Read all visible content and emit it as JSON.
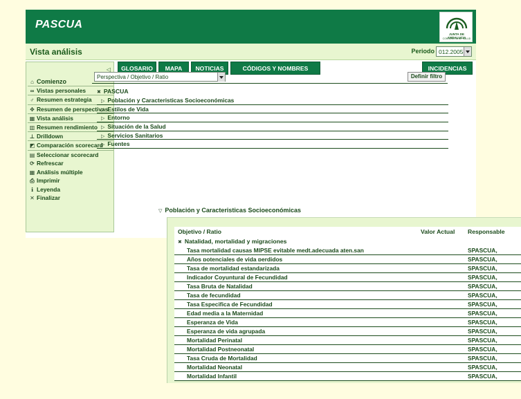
{
  "app": {
    "title": "PASCUA",
    "logo_text": "JUNTA DE ANDALUCIA",
    "logo_sub": "CONSEJERIA DE SALUD"
  },
  "subbar": {
    "view_title": "Vista análisis",
    "period_label": "Periodo",
    "period_value": "012.2005"
  },
  "sidebar": {
    "collapse_symbol": "◁",
    "items": [
      {
        "label": "Comienzo",
        "icon": "home-icon",
        "glyph": "⌂"
      },
      {
        "label": "Vistas personales",
        "icon": "glasses-icon",
        "glyph": "∞"
      },
      {
        "label": "Resumen estrategia",
        "icon": "strategy-icon",
        "glyph": "♂"
      },
      {
        "label": "Resumen de perspectivas",
        "icon": "perspectives-icon",
        "glyph": "✥"
      },
      {
        "label": "Vista análisis",
        "icon": "analysis-grid-icon",
        "glyph": "▦"
      },
      {
        "label": "Resumen rendimiento",
        "icon": "performance-icon",
        "glyph": "▥"
      },
      {
        "label": "Drilldown",
        "icon": "drilldown-icon",
        "glyph": "⊥"
      },
      {
        "label": "Comparación scorecard",
        "icon": "comparison-icon",
        "glyph": "◩"
      }
    ],
    "actions": [
      {
        "label": "Seleccionar scorecard",
        "icon": "select-scorecard-icon",
        "glyph": "▤"
      },
      {
        "label": "Refrescar",
        "icon": "refresh-icon",
        "glyph": "⟳"
      },
      {
        "label": "Análisis múltiple",
        "icon": "multiple-analysis-icon",
        "glyph": "▦"
      },
      {
        "label": "Imprimir",
        "icon": "print-icon",
        "glyph": "⎙"
      },
      {
        "label": "Leyenda",
        "icon": "legend-icon",
        "glyph": "ℹ"
      },
      {
        "label": "Finalizar",
        "icon": "close-icon",
        "glyph": "✕"
      }
    ]
  },
  "tabs": {
    "glosario": "GLOSARIO",
    "mapa": "MAPA",
    "noticias": "NOTICIAS",
    "codigos": "CÓDIGOS Y NOMBRES",
    "incidencias": "INCIDENCIAS"
  },
  "toolbar": {
    "perspective_value": "Perspectiva / Objetivo / Ratio",
    "filter_label": "Definir filtro"
  },
  "tree": {
    "root": "PASCUA",
    "nodes": [
      "Población y Caracteristicas Socioeconómicas",
      "Estilos de Vida",
      "Entorno",
      "Situación de la Salud",
      "Servicios Sanitarios",
      "Fuentes"
    ]
  },
  "detail": {
    "title": "Población y Caracteristicas Socioeconómicas",
    "col_ratio": "Objetivo / Ratio",
    "col_valor": "Valor Actual",
    "col_resp": "Responsable",
    "group": "Natalidad, mortalidad y migraciones",
    "rows": [
      {
        "name": "Tasa mortalidad causas MIPSE evitable medt.adecuada aten.san",
        "resp": "SPASCUA,"
      },
      {
        "name": "Años potenciales de vida perdidos",
        "resp": "SPASCUA,"
      },
      {
        "name": "Tasa de mortalidad estandarizada",
        "resp": "SPASCUA,"
      },
      {
        "name": "Indicador Coyuntural de Fecundidad",
        "resp": "SPASCUA,"
      },
      {
        "name": "Tasa Bruta de Natalidad",
        "resp": "SPASCUA,"
      },
      {
        "name": "Tasa de fecundidad",
        "resp": "SPASCUA,"
      },
      {
        "name": "Tasa Especifica de Fecundidad",
        "resp": "SPASCUA,"
      },
      {
        "name": "Edad media a la Maternidad",
        "resp": "SPASCUA,"
      },
      {
        "name": "Esperanza de Vida",
        "resp": "SPASCUA,"
      },
      {
        "name": "Esperanza de vida agrupada",
        "resp": "SPASCUA,"
      },
      {
        "name": "Mortalidad Perinatal",
        "resp": "SPASCUA,"
      },
      {
        "name": "Mortalidad Postneonatal",
        "resp": "SPASCUA,"
      },
      {
        "name": "Tasa Cruda de Mortalidad",
        "resp": "SPASCUA,"
      },
      {
        "name": "Mortalidad Neonatal",
        "resp": "SPASCUA,"
      },
      {
        "name": "Mortalidad Infantil",
        "resp": "SPASCUA,"
      }
    ]
  },
  "colors": {
    "header_green": "#0f7a46",
    "panel_green": "#e8f6d0",
    "page_yellow": "#fffde0",
    "text_green": "#1a4a1a"
  }
}
